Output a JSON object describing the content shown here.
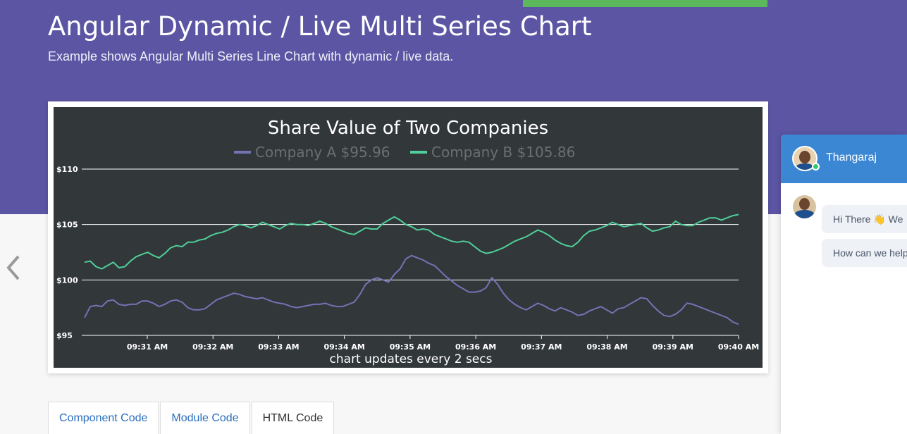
{
  "page": {
    "title": "Angular Dynamic / Live Multi Series Chart",
    "subtitle": "Example shows Angular Multi Series Line Chart with dynamic / live data."
  },
  "tabs": [
    {
      "label": "Component Code",
      "active": false
    },
    {
      "label": "Module Code",
      "active": false
    },
    {
      "label": "HTML Code",
      "active": true
    }
  ],
  "chat": {
    "agent_name": "Thangaraj",
    "messages": [
      "Hi There 👋 We",
      "How can we help"
    ]
  },
  "colors": {
    "hero_bg": "#5b55a4",
    "chart_bg": "#32373a",
    "series_a": "#7273b3",
    "series_b": "#4fcf99",
    "chat_header": "#3c87d3"
  },
  "chart_data": {
    "type": "line",
    "title": "Share Value of Two Companies",
    "footer": "chart updates every 2 secs",
    "y_tick_labels": [
      "$95",
      "$100",
      "$105",
      "$110"
    ],
    "ylim": [
      95,
      110
    ],
    "x_tick_labels": [
      "09:31 AM",
      "09:32 AM",
      "09:33 AM",
      "09:34 AM",
      "09:35 AM",
      "09:36 AM",
      "09:37 AM",
      "09:38 AM",
      "09:39 AM",
      "09:40 AM"
    ],
    "x_start_time": "09:30:06 AM",
    "x_end_time": "09:40 AM",
    "grid": "horizontal",
    "legend_position": "top",
    "series": [
      {
        "name": "Company A",
        "legend_value": "$95.96",
        "color": "#7273b3",
        "values": [
          96.6,
          97.6,
          97.7,
          97.6,
          98.1,
          98.2,
          97.8,
          97.7,
          97.8,
          97.8,
          98.1,
          98.1,
          97.9,
          97.6,
          97.8,
          98.1,
          98.2,
          98.0,
          97.5,
          97.3,
          97.3,
          97.4,
          97.8,
          98.2,
          98.4,
          98.6,
          98.8,
          98.7,
          98.5,
          98.4,
          98.3,
          98.4,
          98.2,
          98.0,
          97.9,
          97.8,
          97.6,
          97.5,
          97.6,
          97.7,
          97.8,
          97.8,
          97.9,
          97.7,
          97.6,
          97.6,
          97.8,
          98.0,
          98.7,
          99.6,
          100.0,
          100.2,
          100.0,
          99.8,
          100.5,
          101.0,
          101.9,
          102.2,
          102.0,
          101.8,
          101.5,
          101.3,
          100.8,
          100.3,
          99.9,
          99.5,
          99.2,
          98.9,
          98.9,
          99.0,
          99.3,
          100.2,
          99.6,
          98.8,
          98.2,
          97.8,
          97.5,
          97.3,
          97.6,
          97.9,
          97.7,
          97.4,
          97.2,
          97.5,
          97.3,
          97.1,
          96.8,
          96.9,
          97.2,
          97.4,
          97.6,
          97.3,
          97.0,
          97.4,
          97.5,
          97.8,
          98.1,
          98.4,
          98.3,
          97.7,
          97.2,
          96.8,
          96.7,
          96.9,
          97.3,
          97.9,
          97.8,
          97.6,
          97.4,
          97.2,
          97.0,
          96.8,
          96.6,
          96.2,
          96.0
        ]
      },
      {
        "name": "Company B",
        "legend_value": "$105.86",
        "color": "#4fcf99",
        "values": [
          101.6,
          101.7,
          101.2,
          101.0,
          101.3,
          101.6,
          101.1,
          101.2,
          101.7,
          102.1,
          102.3,
          102.5,
          102.2,
          102.0,
          102.4,
          102.9,
          103.1,
          103.0,
          103.4,
          103.4,
          103.6,
          103.7,
          104.0,
          104.2,
          104.3,
          104.5,
          104.8,
          105.0,
          104.9,
          104.7,
          104.9,
          105.2,
          105.0,
          104.8,
          104.6,
          104.9,
          105.1,
          105.0,
          105.0,
          104.9,
          105.1,
          105.3,
          105.1,
          104.8,
          104.6,
          104.4,
          104.2,
          104.1,
          104.4,
          104.7,
          104.6,
          104.6,
          105.1,
          105.4,
          105.7,
          105.4,
          105.0,
          104.8,
          104.5,
          104.6,
          104.5,
          104.1,
          103.9,
          103.7,
          103.5,
          103.4,
          103.5,
          103.4,
          103.0,
          102.6,
          102.4,
          102.5,
          102.7,
          102.9,
          103.2,
          103.5,
          103.7,
          103.9,
          104.2,
          104.5,
          104.3,
          104.0,
          103.6,
          103.3,
          103.1,
          103.0,
          103.4,
          104.0,
          104.4,
          104.5,
          104.7,
          104.9,
          105.2,
          105.0,
          104.8,
          104.9,
          105.0,
          105.1,
          104.7,
          104.4,
          104.5,
          104.7,
          104.8,
          105.3,
          105.0,
          104.9,
          104.9,
          105.2,
          105.4,
          105.6,
          105.6,
          105.4,
          105.6,
          105.8,
          105.9
        ]
      }
    ]
  }
}
